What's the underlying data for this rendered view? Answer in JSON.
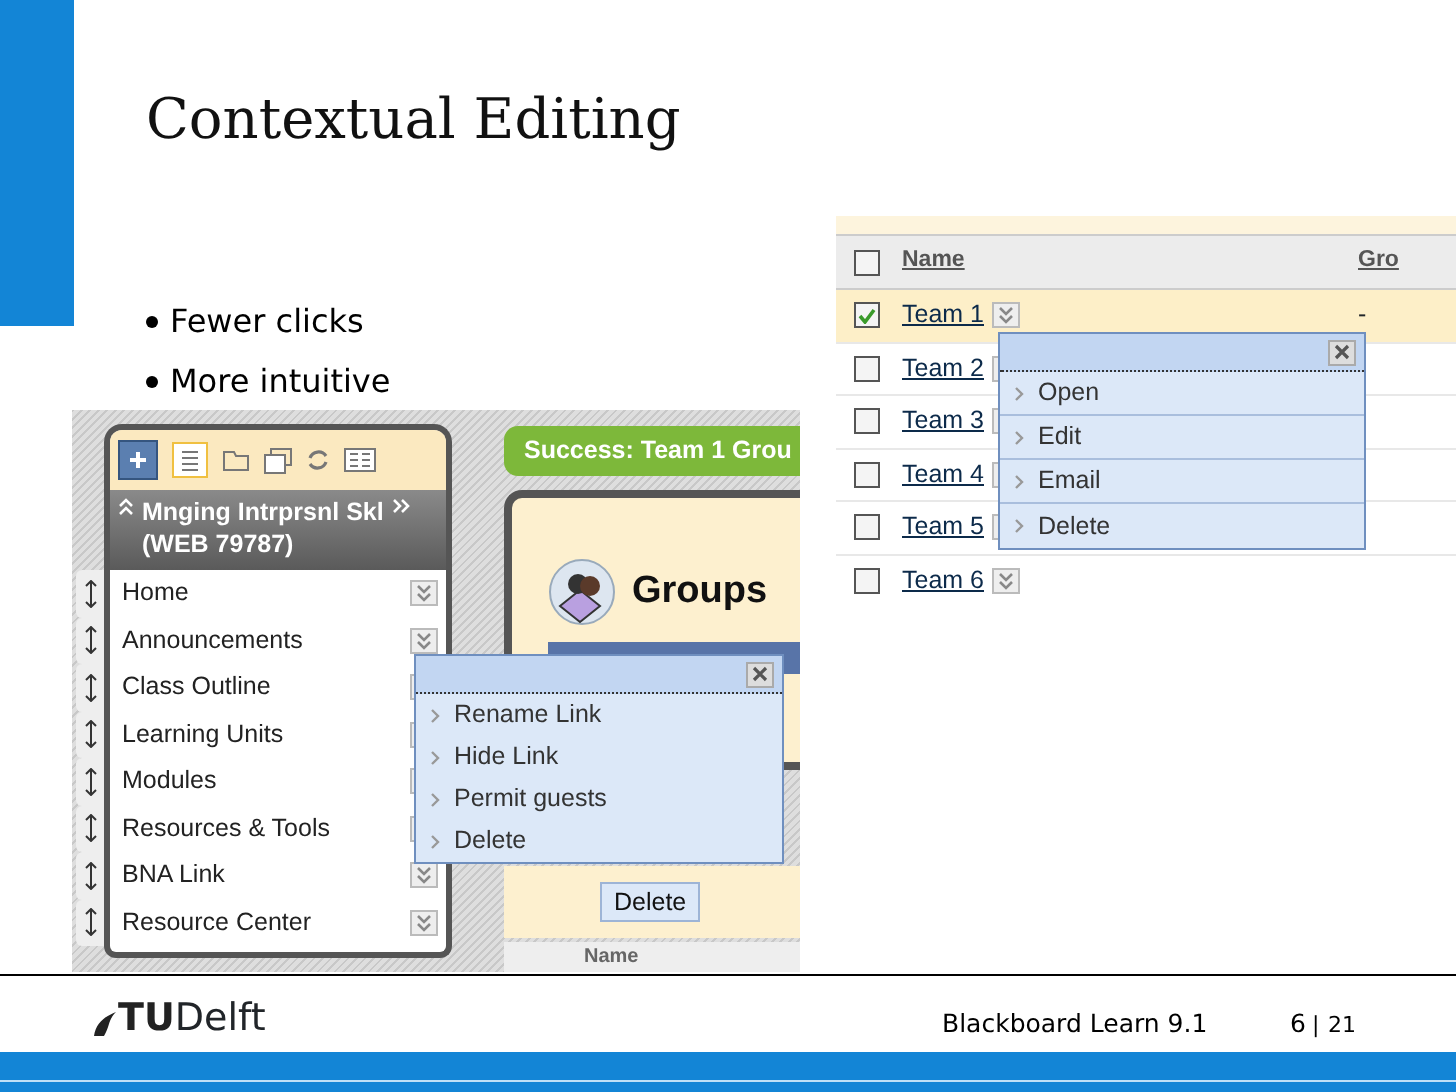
{
  "slide": {
    "title": "Contextual Editing",
    "bullets": [
      "Fewer clicks",
      "More intuitive"
    ]
  },
  "course_menu_screenshot": {
    "course_title": "Mnging Intrprsnl Skl",
    "course_id": "(WEB 79787)",
    "menu_items": [
      "Home",
      "Announcements",
      "Class Outline",
      "Learning Units",
      "Modules",
      "Resources & Tools",
      "BNA Link",
      "Resource Center"
    ],
    "success_message": "Success: Team 1 Grou",
    "page_title": "Groups",
    "delete_button": "Delete",
    "column_header": "Name",
    "context_menu": [
      "Rename Link",
      "Hide Link",
      "Permit guests",
      "Delete"
    ]
  },
  "groups_screenshot": {
    "select_all_checked": false,
    "columns": [
      "Name",
      "Gro"
    ],
    "rows": [
      {
        "name": "Team 1",
        "selected": true,
        "column_2": "-"
      },
      {
        "name": "Team 2",
        "selected": false
      },
      {
        "name": "Team 3",
        "selected": false
      },
      {
        "name": "Team 4",
        "selected": false
      },
      {
        "name": "Team 5",
        "selected": false
      },
      {
        "name": "Team 6",
        "selected": false
      }
    ],
    "context_menu": [
      "Open",
      "Edit",
      "Email",
      "Delete"
    ]
  },
  "footer": {
    "logo_prefix": "TU",
    "logo_name": "Delft",
    "presentation": "Blackboard Learn 9.1",
    "page": "6",
    "separator": "|",
    "total": "21"
  }
}
